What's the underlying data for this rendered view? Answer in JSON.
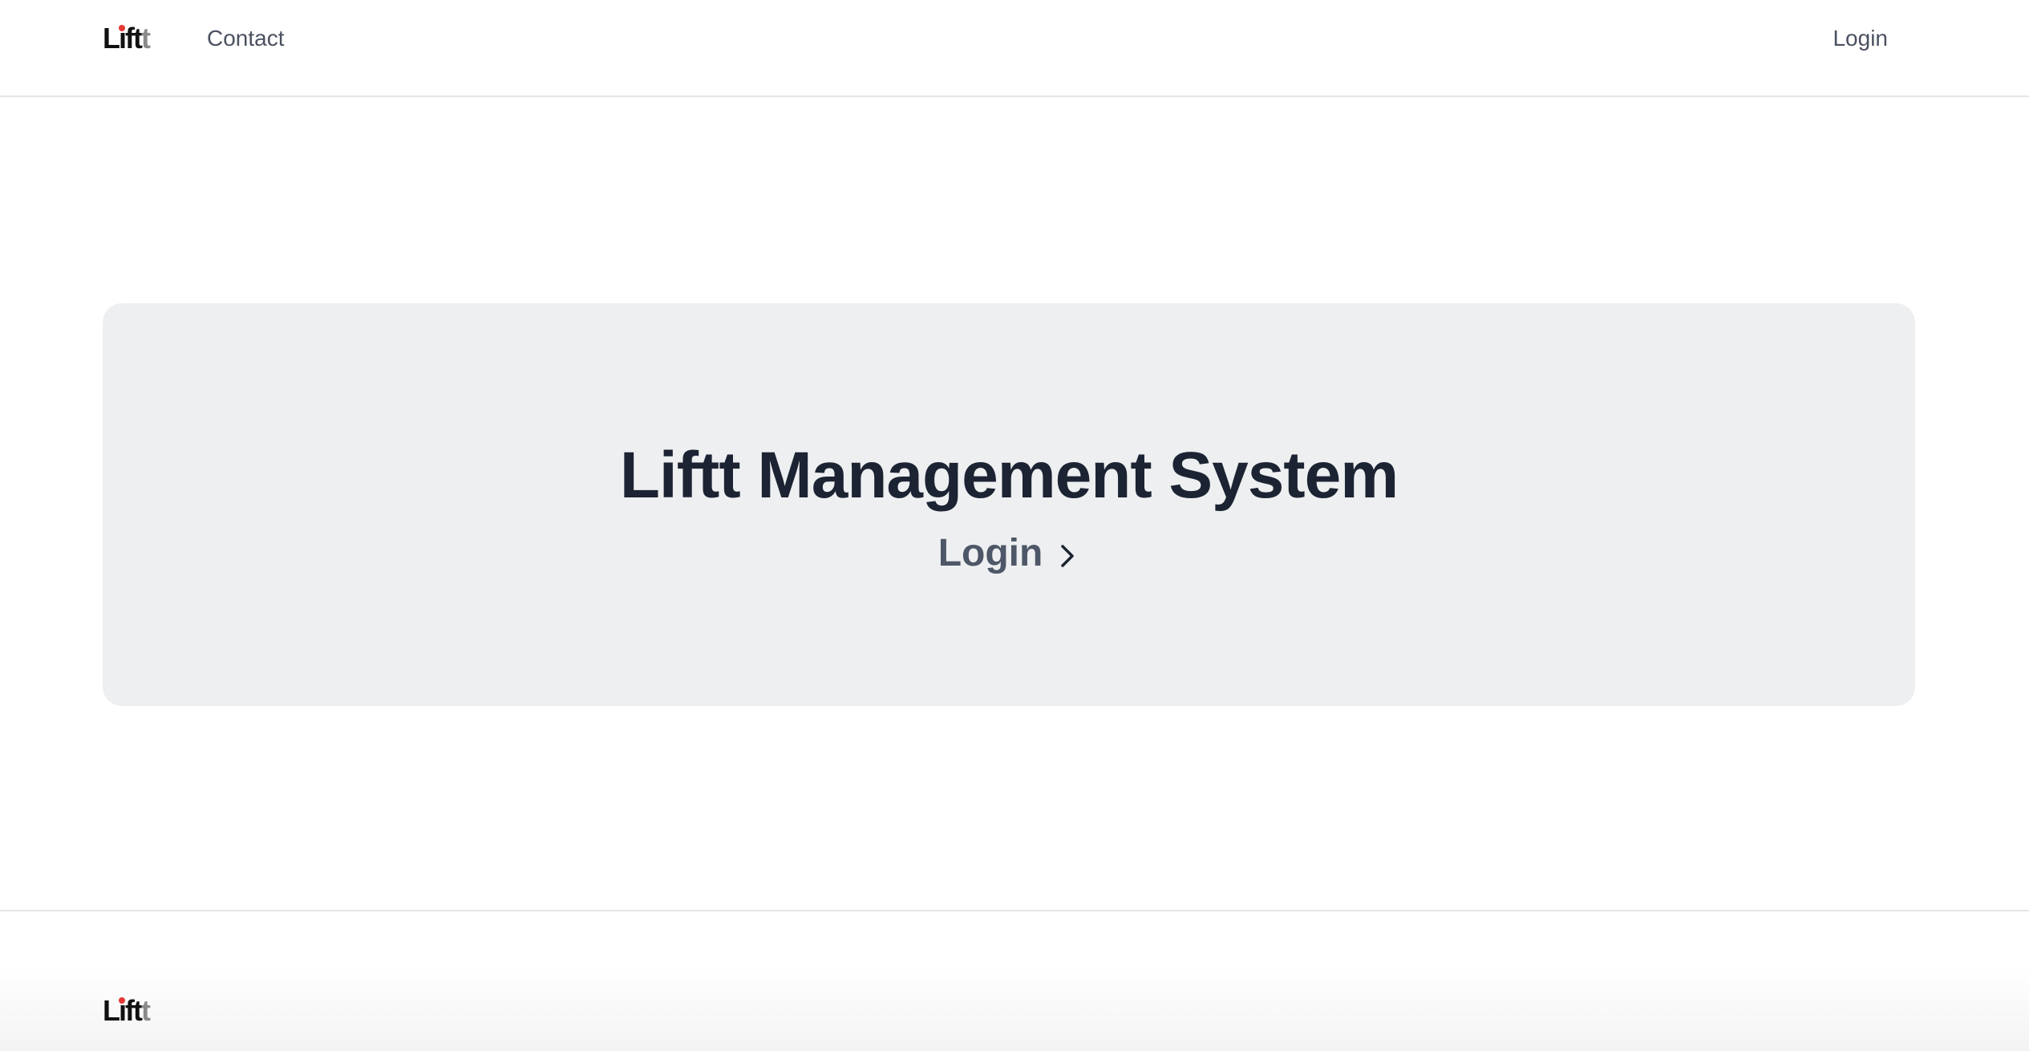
{
  "header": {
    "logo_text": "Liftt",
    "nav": {
      "contact_label": "Contact",
      "login_label": "Login"
    }
  },
  "hero": {
    "title": "Liftt Management System",
    "login_label": "Login",
    "login_icon": "chevron-right-icon"
  },
  "footer": {
    "logo_text": "Liftt"
  },
  "colors": {
    "logo_dot": "#e53935",
    "hero_background": "#eeeff1",
    "title_text": "#1c2433",
    "nav_text": "#4a5160"
  }
}
